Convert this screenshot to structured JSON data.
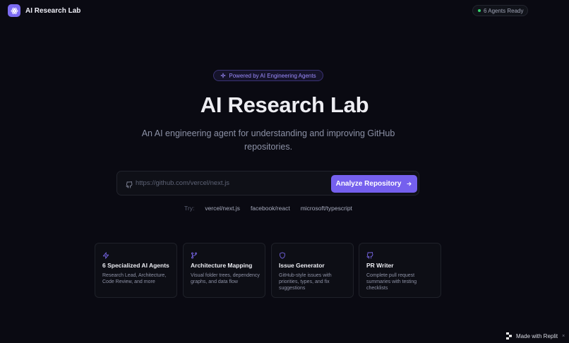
{
  "brand": {
    "name": "AI Research Lab"
  },
  "status": {
    "label": "6 Agents Ready",
    "dot_color": "#34d36b"
  },
  "hero": {
    "badge": "Powered by AI Engineering Agents",
    "title": "AI Research Lab",
    "subtitle": "An AI engineering agent for understanding and improving GitHub repositories."
  },
  "search": {
    "placeholder": "https://github.com/vercel/next.js",
    "value": "",
    "button_label": "Analyze Repository"
  },
  "try": {
    "label": "Try:",
    "examples": [
      "vercel/next.js",
      "facebook/react",
      "microsoft/typescript"
    ]
  },
  "features": [
    {
      "icon": "lightning-icon",
      "title": "6 Specialized AI Agents",
      "description": "Research Lead, Architecture, Code Review, and more"
    },
    {
      "icon": "git-branch-icon",
      "title": "Architecture Mapping",
      "description": "Visual folder trees, dependency graphs, and data flow"
    },
    {
      "icon": "shield-icon",
      "title": "Issue Generator",
      "description": "GitHub-style issues with priorities, types, and fix suggestions"
    },
    {
      "icon": "github-icon",
      "title": "PR Writer",
      "description": "Complete pull request summaries with testing checklists"
    }
  ],
  "footer": {
    "made_with": "Made with Replit",
    "close_glyph": "×"
  },
  "colors": {
    "background": "#0a0a12",
    "accent": "#7560ee",
    "accent_text": "#9d8cff"
  }
}
